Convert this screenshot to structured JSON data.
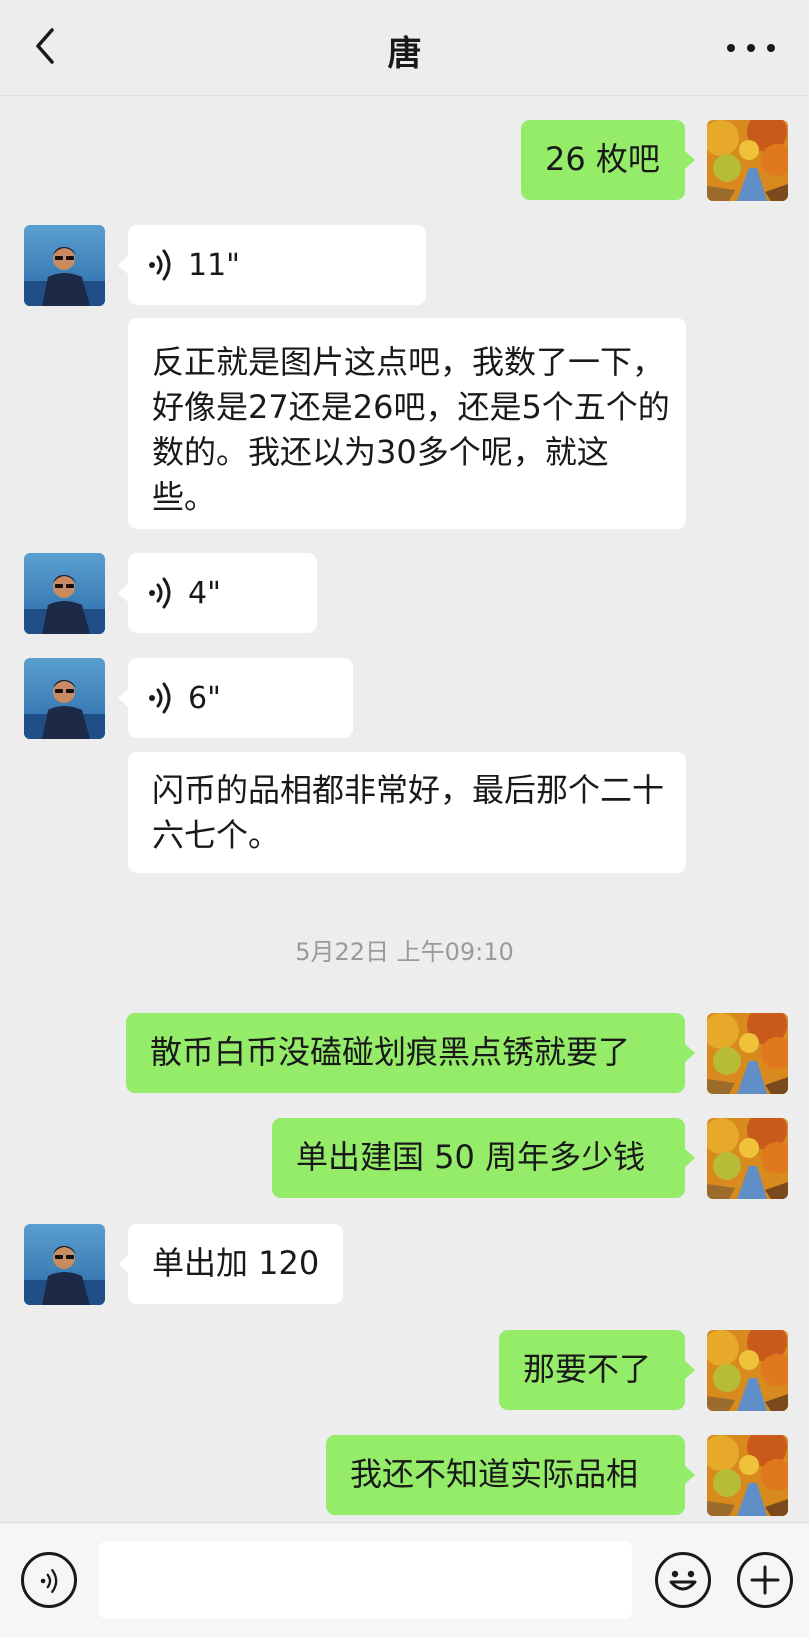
{
  "header": {
    "title": "唐"
  },
  "messages": {
    "m1": {
      "text": "26 枚吧"
    },
    "m2": {
      "duration": "11\""
    },
    "m3": {
      "text": "反正就是图片这点吧，我数了一下，好像是27还是26吧，还是5个五个的数的。我还以为30多个呢，就这些。"
    },
    "m4": {
      "duration": "4\""
    },
    "m5": {
      "duration": "6\""
    },
    "m6": {
      "text": "闪币的品相都非常好，最后那个二十六七个。"
    },
    "m7": {
      "text": "散币白币没磕碰划痕黑点锈就要了"
    },
    "m8": {
      "text": "单出建国 50 周年多少钱"
    },
    "m9": {
      "text": "单出加 120"
    },
    "m10": {
      "text": "那要不了"
    },
    "m11": {
      "text": "我还不知道实际品相"
    }
  },
  "timestamp": "5月22日 上午09:10",
  "input": {
    "value": ""
  },
  "icons": {
    "back": "chevron-left-icon",
    "more": "more-dots-icon",
    "voice": "voice-wave-icon",
    "voice_toggle": "voice-toggle-icon",
    "emoji": "emoji-icon",
    "plus": "plus-icon"
  },
  "colors": {
    "outgoing_bubble": "#95ec69",
    "incoming_bubble": "#ffffff",
    "background": "#ededed"
  }
}
